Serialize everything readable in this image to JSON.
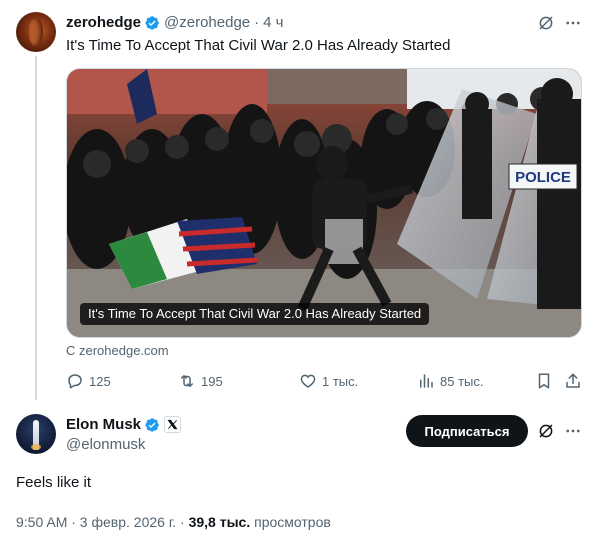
{
  "quoted_tweet": {
    "author_name": "zerohedge",
    "author_handle": "@zerohedge",
    "separator": "·",
    "time_ago": "4 ч",
    "text": "It's Time To Accept That Civil War 2.0 Has Already Started",
    "media": {
      "caption": "It's Time To Accept That Civil War 2.0 Has Already Started",
      "sign_text": "POLICE"
    },
    "source_link": "С zerohedge.com",
    "actions": {
      "replies": "125",
      "reposts": "195",
      "likes": "1 тыс.",
      "views": "85 тыс."
    },
    "icons": [
      "verified-badge-icon",
      "grok-icon",
      "more-icon",
      "reply-icon",
      "repost-icon",
      "like-icon",
      "views-icon",
      "bookmark-icon",
      "share-icon"
    ]
  },
  "main_tweet": {
    "author_name": "Elon Musk",
    "author_handle": "@elonmusk",
    "subscribe_label": "Подписаться",
    "text": "Feels like it",
    "timestamp": "9:50 AM · 3 февр. 2026 г.",
    "separator": "·",
    "views_count": "39,8 тыс.",
    "views_label": "просмотров",
    "icons": [
      "verified-badge-icon",
      "x-affiliate-icon",
      "grok-icon",
      "more-icon"
    ]
  },
  "colors": {
    "text_primary": "#0f1419",
    "text_secondary": "#536471",
    "verified_blue": "#1d9bf0",
    "border": "#cfd9de",
    "button_bg": "#0f1419"
  }
}
